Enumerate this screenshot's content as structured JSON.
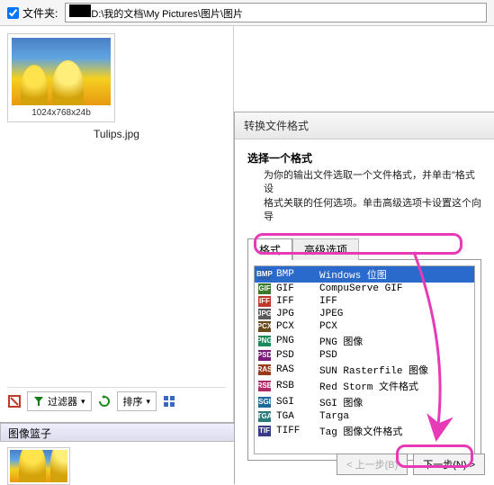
{
  "top": {
    "folder_label": "文件夹:",
    "path": "D:\\我的文档\\My Pictures\\图片\\图片"
  },
  "thumbnail": {
    "dims": "1024x768x24b",
    "name": "Tulips.jpg"
  },
  "toolbar": {
    "filter_label": "过滤器",
    "sort_label": "排序"
  },
  "basket": {
    "title": "图像篮子"
  },
  "dialog": {
    "title": "转换文件格式",
    "heading": "选择一个格式",
    "desc1": "为你的输出文件选取一个文件格式，并单击\"格式设",
    "desc2": "格式关联的任何选项。单击高级选项卡设置这个向导",
    "tab_format": "格式",
    "tab_advanced": "高级选项",
    "prev": "< 上一步(B)",
    "next": "下一步(N) >"
  },
  "formats": [
    {
      "ext": "BMP",
      "desc": "Windows 位图",
      "color": "#2b60b0",
      "selected": true
    },
    {
      "ext": "GIF",
      "desc": "CompuServe GIF",
      "color": "#3a7a2a"
    },
    {
      "ext": "IFF",
      "desc": "IFF",
      "color": "#c0392b"
    },
    {
      "ext": "JPG",
      "desc": "JPEG",
      "color": "#5a5a5a"
    },
    {
      "ext": "PCX",
      "desc": "PCX",
      "color": "#6b4a1a"
    },
    {
      "ext": "PNG",
      "desc": "PNG 图像",
      "color": "#1a8a5a"
    },
    {
      "ext": "PSD",
      "desc": "PSD",
      "color": "#7a1a7a"
    },
    {
      "ext": "RAS",
      "desc": "SUN Rasterfile 图像",
      "color": "#9a3a1a"
    },
    {
      "ext": "RSB",
      "desc": "Red Storm 文件格式",
      "color": "#b02a6a"
    },
    {
      "ext": "SGI",
      "desc": "SGI 图像",
      "color": "#1a6a9a"
    },
    {
      "ext": "TGA",
      "desc": "Targa",
      "color": "#2a7a7a"
    },
    {
      "ext": "TIFF",
      "desc": "Tag 图像文件格式",
      "color": "#3a3a8a"
    }
  ]
}
